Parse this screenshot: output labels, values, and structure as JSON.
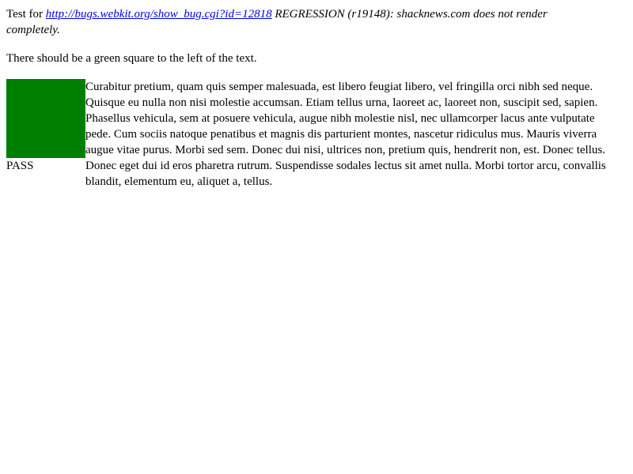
{
  "intro": {
    "prefix": "Test for ",
    "link_text": "http://bugs.webkit.org/show_bug.cgi?id=12818",
    "description_line1": " REGRESSION (r19148): shacknews.com does not render",
    "description_line2": "completely."
  },
  "instruction": "There should be a green square to the left of the text.",
  "test": {
    "square_color": "#008000",
    "result_label": "PASS",
    "paragraph_lines": [
      "Curabitur pretium, quam quis semper malesuada, est libero feugiat libero, vel fringilla orci nibh sed neque.",
      "Quisque eu nulla non nisi molestie accumsan. Etiam tellus urna, laoreet ac, laoreet non, suscipit sed, sapien.",
      "Phasellus vehicula, sem at posuere vehicula, augue nibh molestie nisl, nec ullamcorper lacus ante vulputate",
      "pede. Cum sociis natoque penatibus et magnis dis parturient montes, nascetur ridiculus mus. Mauris viverra",
      "augue vitae purus. Morbi sed sem. Donec dui nisi, ultrices non, pretium quis, hendrerit non, est. Donec tellus.",
      "Donec eget dui id eros pharetra rutrum. Suspendisse sodales lectus sit amet nulla. Morbi tortor arcu, convallis",
      "blandit, elementum eu, aliquet a, tellus."
    ]
  }
}
